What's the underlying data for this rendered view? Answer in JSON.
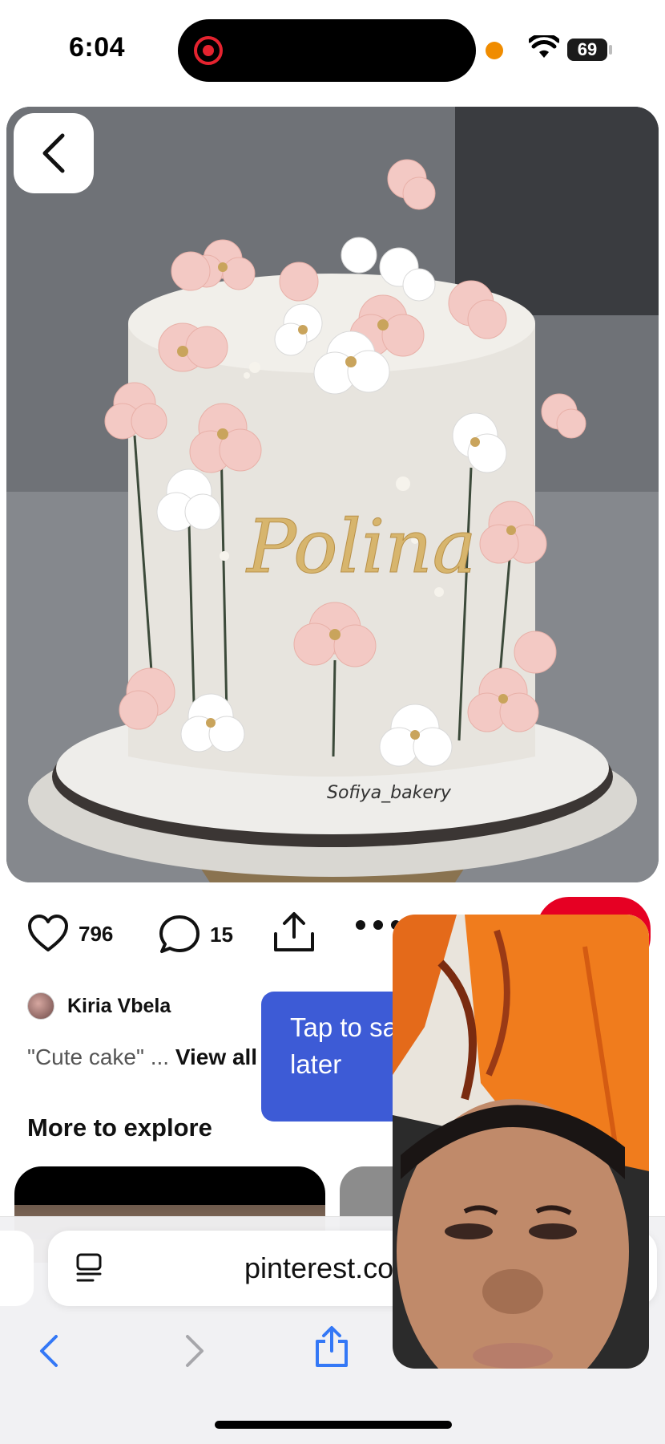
{
  "status_bar": {
    "time": "6:04",
    "battery": "69"
  },
  "pin": {
    "cake_lettering": "Polina",
    "watermark": "Sofiya_bakery",
    "likes": "796",
    "comments": "15",
    "author": "Kiria Vbela",
    "description_quote": "\"Cute cake\" ...",
    "description_link": "View all"
  },
  "explore": {
    "title": "More to explore"
  },
  "tooltip": {
    "line1": "Tap to sa",
    "line2": "later"
  },
  "browser": {
    "url": "pinterest.co"
  },
  "colors": {
    "save_red": "#e60023",
    "tooltip_blue": "#3d5bd6",
    "safari_blue": "#3478f6"
  },
  "icons": [
    "back-chevron-icon",
    "heart-icon",
    "comment-icon",
    "share-icon",
    "more-icon",
    "reader-icon",
    "back-icon",
    "forward-icon",
    "safari-share-icon"
  ]
}
